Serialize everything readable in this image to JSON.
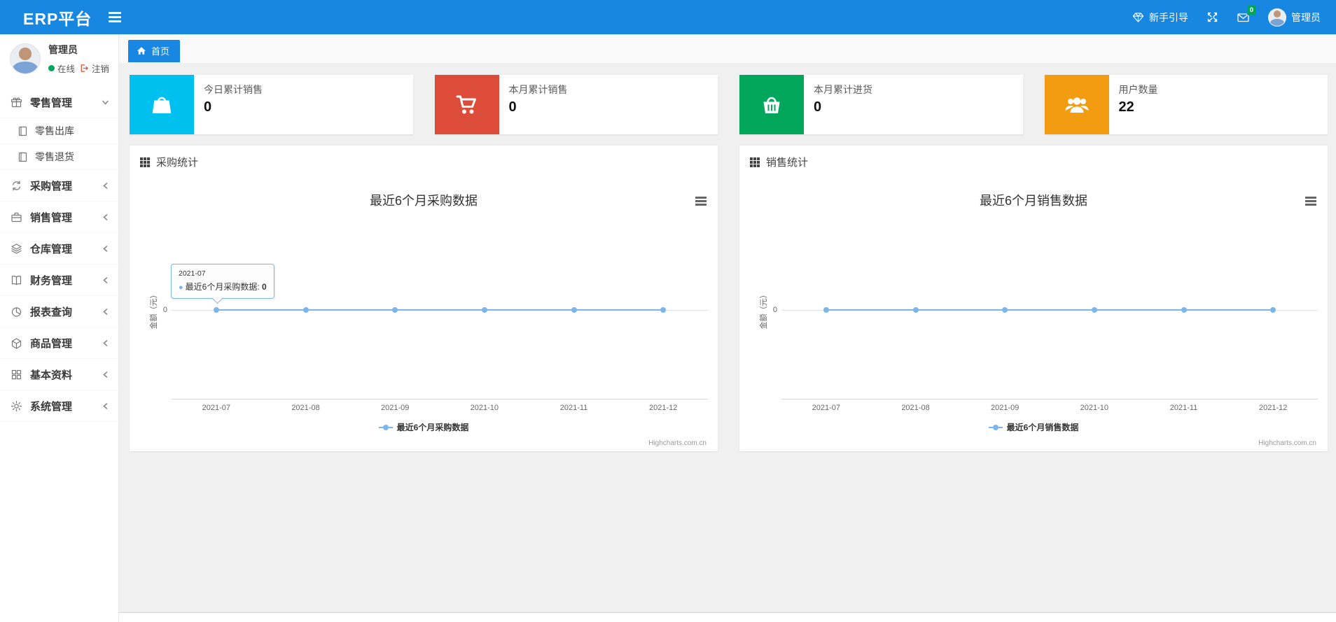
{
  "colors": {
    "navbar": "#1787e1",
    "series": "#7cb5ec",
    "status_online": "#00a65a",
    "logout_red": "#dd4b39"
  },
  "navbar": {
    "brand": "ERP平台",
    "guide_label": "新手引导",
    "guide_icon": "gem-icon",
    "fullscreen_icon": "expand-icon",
    "mail_icon": "envelope-icon",
    "mail_badge": "0",
    "user_name": "管理员"
  },
  "sidebar": {
    "user": {
      "name": "管理员",
      "status": "在线",
      "logout": "注销"
    },
    "items": [
      {
        "label": "零售管理",
        "icon": "gift-icon",
        "state": "expanded",
        "children": [
          {
            "label": "零售出库",
            "icon": "journal-icon"
          },
          {
            "label": "零售退货",
            "icon": "journal-icon"
          }
        ]
      },
      {
        "label": "采购管理",
        "icon": "repeat-icon",
        "state": "collapsed",
        "children": []
      },
      {
        "label": "销售管理",
        "icon": "briefcase-icon",
        "state": "collapsed",
        "children": []
      },
      {
        "label": "仓库管理",
        "icon": "layers-icon",
        "state": "collapsed",
        "children": []
      },
      {
        "label": "财务管理",
        "icon": "book-icon",
        "state": "collapsed",
        "children": []
      },
      {
        "label": "报表查询",
        "icon": "pie-chart-icon",
        "state": "collapsed",
        "children": []
      },
      {
        "label": "商品管理",
        "icon": "package-icon",
        "state": "collapsed",
        "children": []
      },
      {
        "label": "基本资料",
        "icon": "grid-icon",
        "state": "collapsed",
        "children": []
      },
      {
        "label": "系统管理",
        "icon": "gear-icon",
        "state": "collapsed",
        "children": []
      }
    ]
  },
  "breadcrumb": {
    "home": "首页",
    "home_icon": "home-icon"
  },
  "stat_cards": [
    {
      "label": "今日累计销售",
      "value": "0",
      "color": "#00c0ef",
      "icon": "shopping-bag-icon"
    },
    {
      "label": "本月累计销售",
      "value": "0",
      "color": "#dd4b39",
      "icon": "shopping-cart-icon"
    },
    {
      "label": "本月累计进货",
      "value": "0",
      "color": "#00a65a",
      "icon": "shopping-basket-icon"
    },
    {
      "label": "用户数量",
      "value": "22",
      "color": "#f39c12",
      "icon": "users-icon"
    }
  ],
  "chart_data": [
    {
      "type": "line",
      "panel_title": "采购统计",
      "title": "最近6个月采购数据",
      "categories": [
        "2021-07",
        "2021-08",
        "2021-09",
        "2021-10",
        "2021-11",
        "2021-12"
      ],
      "series": [
        {
          "name": "最近6个月采购数据",
          "values": [
            0,
            0,
            0,
            0,
            0,
            0
          ],
          "color": "#7cb5ec"
        }
      ],
      "xlabel": "",
      "ylabel": "金额（元）",
      "yticks": [
        "0"
      ],
      "ylim": [
        0,
        null
      ],
      "grid": "zero-line-only",
      "legend_position": "bottom-center",
      "credit": "Highcharts.com.cn",
      "tooltip": {
        "visible": true,
        "header": "2021-07",
        "label": "最近6个月采购数据: ",
        "value": "0"
      }
    },
    {
      "type": "line",
      "panel_title": "销售统计",
      "title": "最近6个月销售数据",
      "categories": [
        "2021-07",
        "2021-08",
        "2021-09",
        "2021-10",
        "2021-11",
        "2021-12"
      ],
      "series": [
        {
          "name": "最近6个月销售数据",
          "values": [
            0,
            0,
            0,
            0,
            0,
            0
          ],
          "color": "#7cb5ec"
        }
      ],
      "xlabel": "",
      "ylabel": "金额（元）",
      "yticks": [
        "0"
      ],
      "ylim": [
        0,
        null
      ],
      "grid": "zero-line-only",
      "legend_position": "bottom-center",
      "credit": "Highcharts.com.cn",
      "tooltip": {
        "visible": false
      }
    }
  ]
}
